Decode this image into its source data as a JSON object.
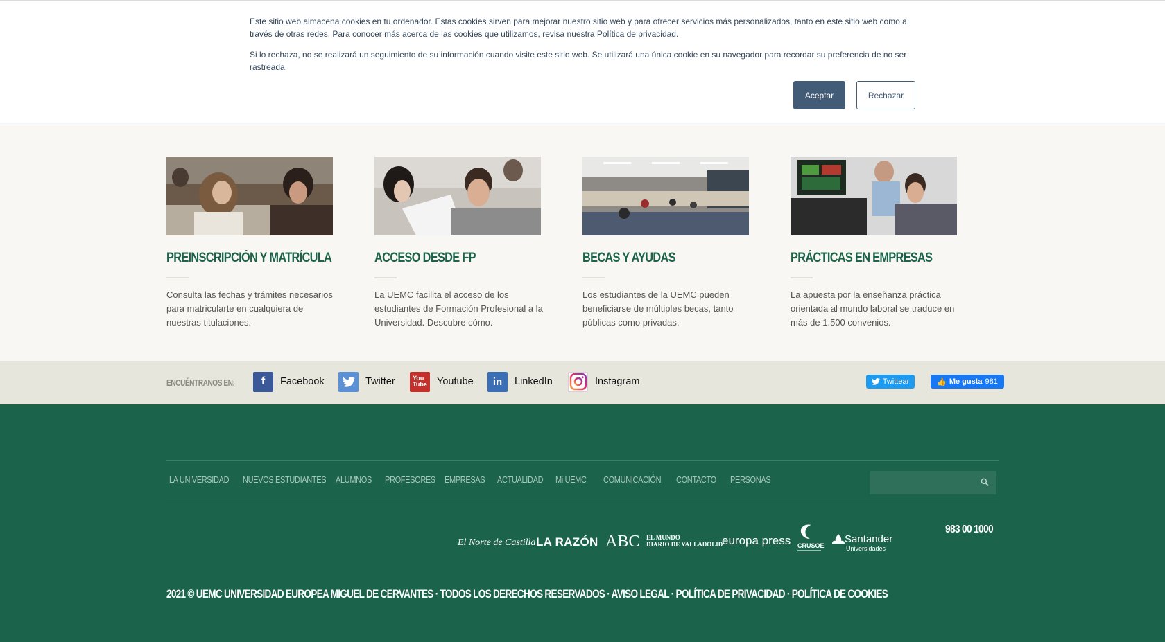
{
  "cookie_banner": {
    "paragraph_1": "Este sitio web almacena cookies en tu ordenador. Estas cookies sirven para mejorar nuestro sitio web y para ofrecer servicios más personalizados, tanto en este sitio web como a través de otras redes. Para conocer más acerca de las cookies que utilizamos, revisa nuestra Política de privacidad.",
    "paragraph_2": "Si lo rechaza, no se realizará un seguimiento de su información cuando visite este sitio web. Se utilizará una única cookie en su navegador para recordar su preferencia de no ser rastreada.",
    "accept_label": "Aceptar",
    "reject_label": "Rechazar"
  },
  "cards": [
    {
      "title": "PREINSCRIPCIÓN Y MATRÍCULA",
      "description": "Consulta las fechas y trámites necesarios para matricularte en cualquiera de nuestras titulaciones."
    },
    {
      "title": "ACCESO DESDE FP",
      "description": "La  UEMC facilita el acceso de los estudiantes de Formación Profesional a la Universidad. Descubre cómo."
    },
    {
      "title": "BECAS Y AYUDAS",
      "description": "Los estudiantes de la UEMC pueden beneficiarse de múltiples becas, tanto públicas como privadas."
    },
    {
      "title": "PRÁCTICAS EN EMPRESAS",
      "description": "La apuesta por la enseñanza práctica orientada al mundo laboral se traduce en más de 1.500 convenios."
    }
  ],
  "social": {
    "label": "ENCUÉNTRANOS EN:",
    "links": [
      {
        "name": "Facebook",
        "icon": "facebook-icon",
        "color": "#3b5998"
      },
      {
        "name": "Twitter",
        "icon": "twitter-icon",
        "color": "#5b8fd6"
      },
      {
        "name": "Youtube",
        "icon": "youtube-icon",
        "color": "#c4302b"
      },
      {
        "name": "LinkedIn",
        "icon": "linkedin-icon",
        "color": "#3a6fb5"
      },
      {
        "name": "Instagram",
        "icon": "instagram-icon",
        "color": "#d6249f"
      }
    ],
    "tweet_label": "Twittear",
    "like_label": "Me gusta",
    "like_count": "981"
  },
  "footer": {
    "nav": [
      "LA UNIVERSIDAD",
      "NUEVOS ESTUDIANTES",
      "ALUMNOS",
      "PROFESORES",
      "EMPRESAS",
      "ACTUALIDAD",
      "Mi UEMC",
      "COMUNICACIÓN",
      "CONTACTO",
      "PERSONAS"
    ],
    "phone": "983 00 1000",
    "logos": {
      "norte": "El Norte de Castilla",
      "razon": "LA RAZÓN",
      "abc": "ABC",
      "mundo_1": "EL MUNDO",
      "mundo_2": "DIARIO DE VALLADOLID",
      "europa": "europa press",
      "crusoe": "CRUSOE",
      "santander_1": "Santander",
      "santander_2": "Universidades"
    },
    "copyright_year": "2021 ©",
    "copyright_org": "UEMC UNIVERSIDAD EUROPEA MIGUEL DE CERVANTES",
    "rights": "· TODOS LOS DERECHOS RESERVADOS ·",
    "aviso": "AVISO LEGAL",
    "privacidad": "POLÍTICA DE PRIVACIDAD",
    "cookies": "POLÍTICA DE COOKIES",
    "sep_1": " · ",
    "sep_2": " · "
  },
  "colors": {
    "brand_green": "#1b634a",
    "accept_button": "#425b76"
  }
}
